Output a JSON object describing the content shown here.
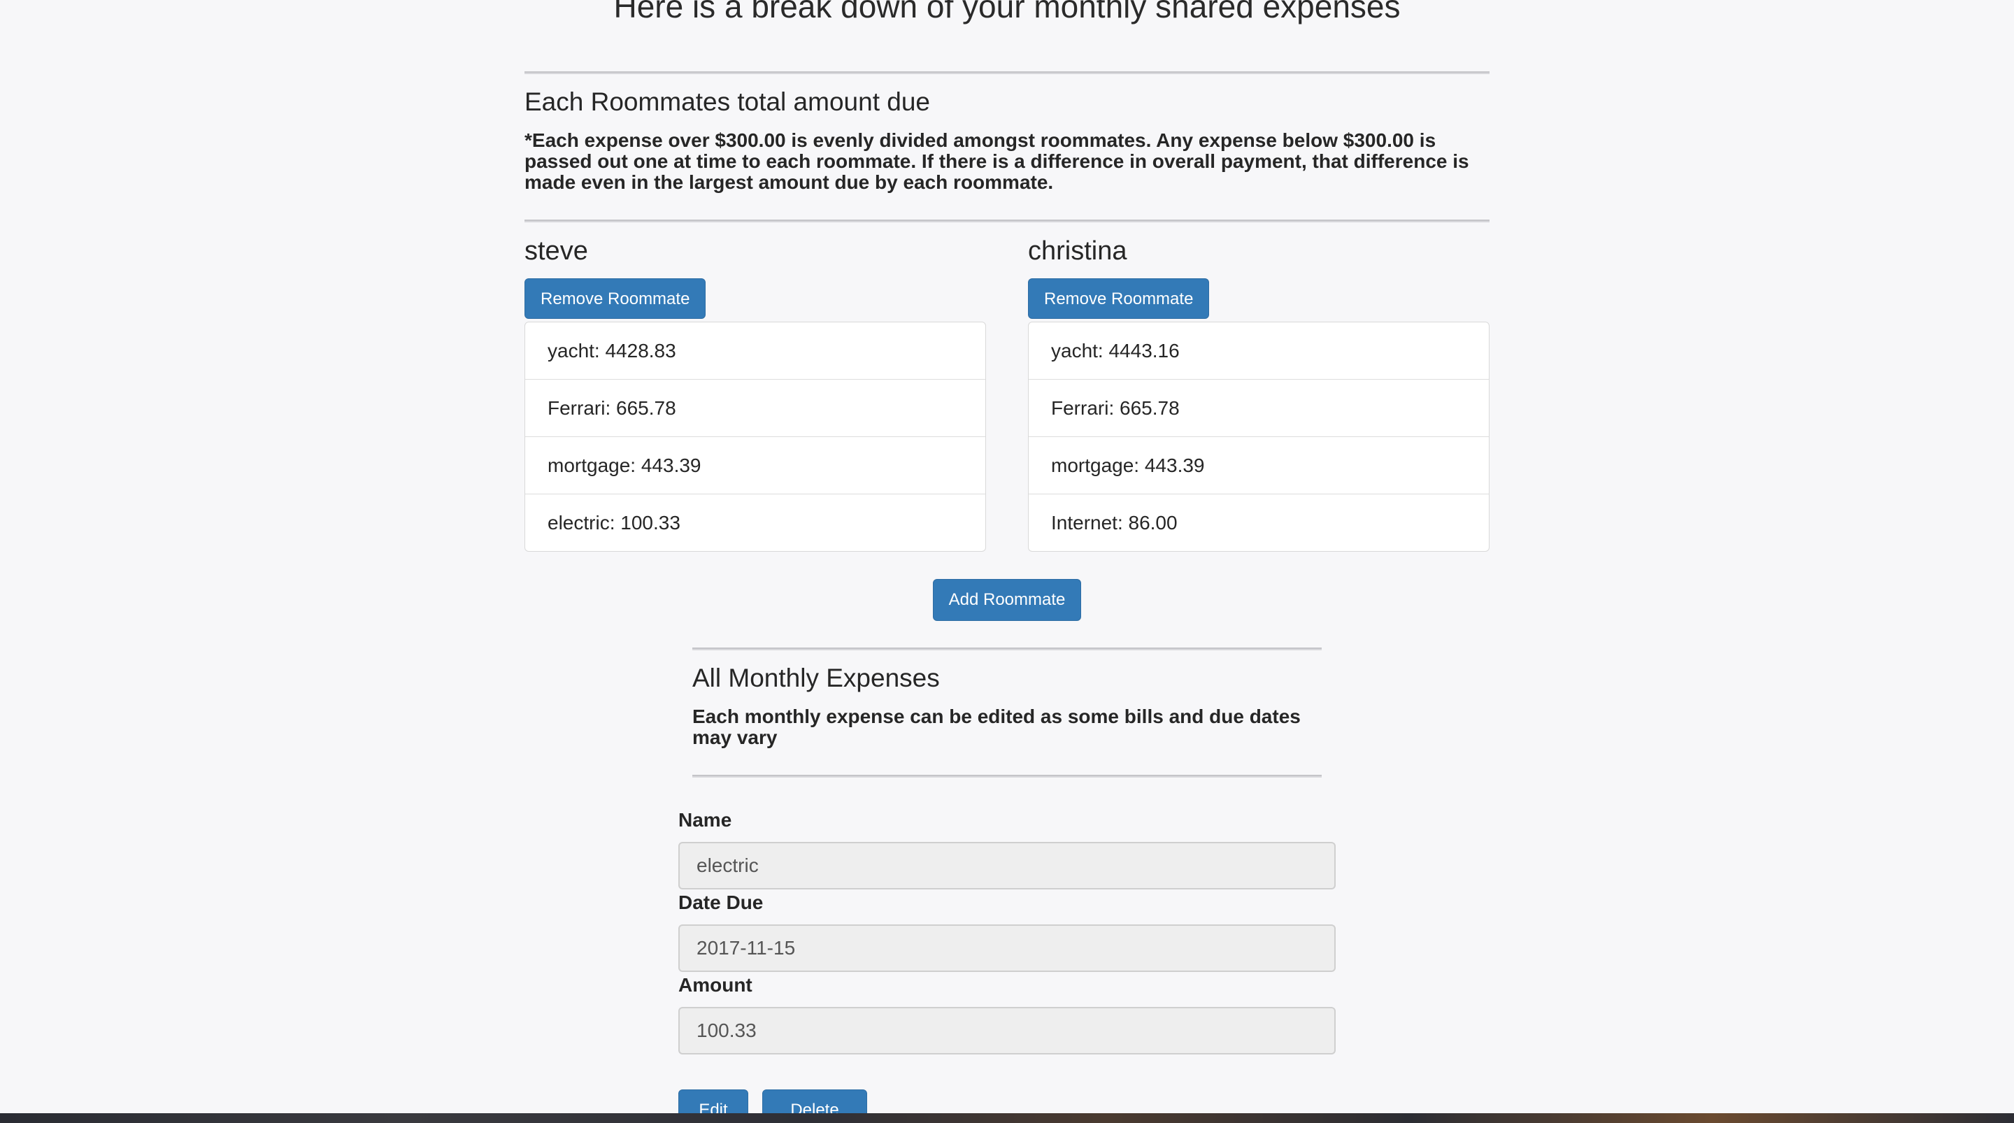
{
  "page": {
    "title": "Here is a break down of your monthly shared expenses"
  },
  "summary": {
    "heading": "Each Roommates total amount due",
    "note": "*Each expense over $300.00 is evenly divided amongst roommates. Any expense below $300.00 is passed out one at time to each roommate. If there is a difference in overall payment, that difference is made even in the largest amount due by each roommate."
  },
  "roommates": [
    {
      "name": "steve",
      "remove_label": "Remove Roommate",
      "expenses": [
        "yacht: 4428.83",
        "Ferrari: 665.78",
        "mortgage: 443.39",
        "electric: 100.33"
      ]
    },
    {
      "name": "christina",
      "remove_label": "Remove Roommate",
      "expenses": [
        "yacht: 4443.16",
        "Ferrari: 665.78",
        "mortgage: 443.39",
        "Internet: 86.00"
      ]
    }
  ],
  "add_roommate_label": "Add Roommate",
  "monthly": {
    "heading": "All Monthly Expenses",
    "note": "Each monthly expense can be edited as some bills and due dates may vary"
  },
  "form": {
    "name_label": "Name",
    "name_value": "electric",
    "date_label": "Date Due",
    "date_value": "2017-11-15",
    "amount_label": "Amount",
    "amount_value": "100.33",
    "edit_label": "Edit",
    "delete_label": "Delete"
  },
  "colors": {
    "primary": "#337ab7",
    "background": "#f7f7f9"
  }
}
